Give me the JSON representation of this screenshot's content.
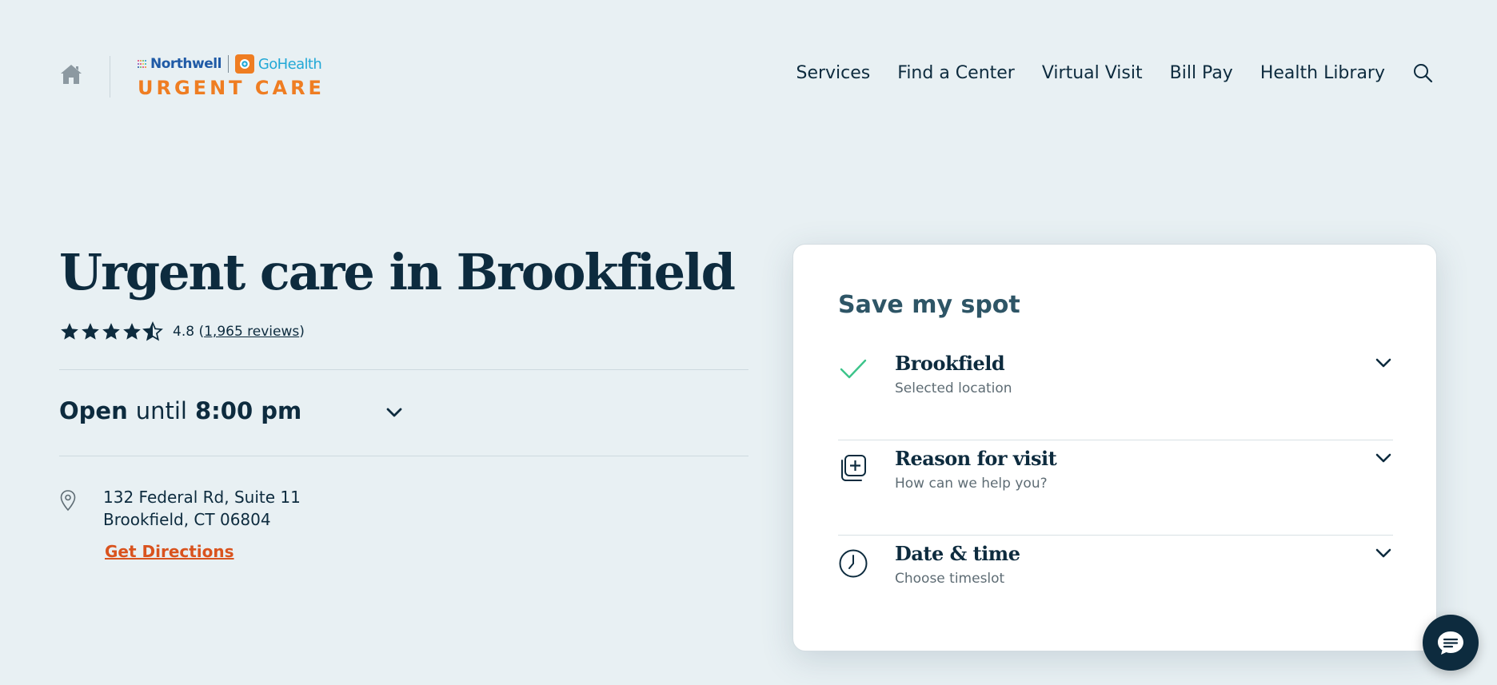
{
  "header": {
    "logo": {
      "northwell": "Northwell",
      "gohealth": "GoHealth",
      "tagline": "URGENT CARE"
    },
    "nav": [
      {
        "label": "Services"
      },
      {
        "label": "Find a Center"
      },
      {
        "label": "Virtual Visit"
      },
      {
        "label": "Bill Pay"
      },
      {
        "label": "Health Library"
      }
    ],
    "icons": {
      "home": "home-icon",
      "search": "search-icon"
    }
  },
  "hero": {
    "title": "Urgent care in Brookfield",
    "rating": {
      "stars": 4.5,
      "value": "4.8",
      "reviews_label": "1,965 reviews"
    },
    "hours": {
      "open": "Open",
      "until": "until",
      "time": "8:00 pm"
    },
    "address": {
      "line1": "132 Federal Rd, Suite 11",
      "line2": "Brookfield, CT 06804",
      "directions_label": "Get Directions"
    }
  },
  "card": {
    "title": "Save my spot",
    "steps": [
      {
        "title": "Brookfield",
        "subtitle": "Selected location",
        "icon": "check-icon"
      },
      {
        "title": "Reason for visit",
        "subtitle": "How can we help you?",
        "icon": "medical-cross-icon"
      },
      {
        "title": "Date & time",
        "subtitle": "Choose timeslot",
        "icon": "clock-icon"
      }
    ]
  },
  "colors": {
    "background": "#e8f0f3",
    "navy": "#0d2b3e",
    "accent_orange": "#d9531e",
    "brand_orange": "#ef7d22",
    "brand_blue": "#1f5aa6",
    "brand_cyan": "#22a8d6",
    "check_green": "#3cc48a"
  }
}
